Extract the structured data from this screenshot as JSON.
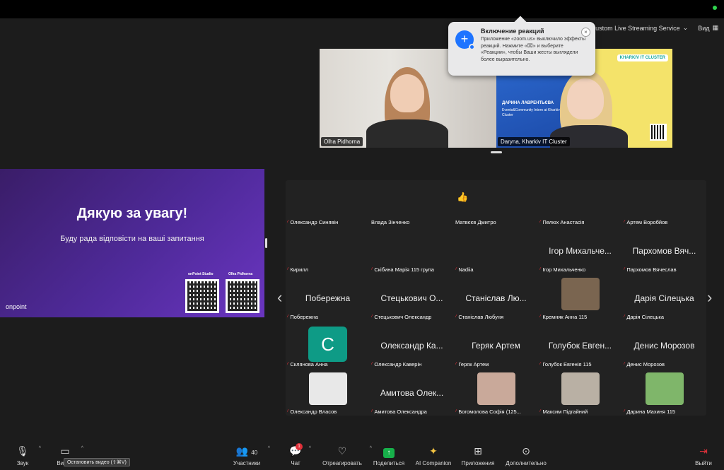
{
  "meeting": {
    "top_bar": {
      "live_label": "Custom Live Streaming Service",
      "view_label": "Вид"
    },
    "popup": {
      "title": "Включение реакций",
      "body": "Приложение «zoom.us» выключило эффекты реакций. Нажмите «⌧» и выберите «Реакции», чтобы Ваши жесты выглядели более выразительно.",
      "close": "×"
    },
    "videos": [
      {
        "name": "Olha Pidhorna"
      },
      {
        "name": "Daryna, Kharkiv IT Cluster",
        "banner_name": "ДАРИНА ЛАВРЕНТЬЄВА",
        "banner_role": "Events&Community Intern at Kharkiv IT Cluster",
        "logo": "KHARKIV IT CLUSTER"
      }
    ],
    "slide": {
      "title": "Дякую за увагу!",
      "subtitle": "Буду рада відповісти на ваші запитання",
      "logo": "onpoint",
      "qr1_label": "onPoint Studio",
      "qr2_label": "Olha Pidhorna"
    },
    "gallery": [
      {
        "label": "Олександр Синявін",
        "big": ""
      },
      {
        "label": "Влада Зінченко",
        "big": "",
        "nomic": true
      },
      {
        "label": "Матвєєв Дмитро",
        "big": "",
        "nomic": true,
        "emoji": "👍"
      },
      {
        "label": "Пелюх Анастасія",
        "big": ""
      },
      {
        "label": "Артем Воробйов",
        "big": ""
      },
      {
        "label": "Кирилл",
        "big": ""
      },
      {
        "label": "Скібина Марія 115 група",
        "big": ""
      },
      {
        "label": "Nadiia",
        "big": ""
      },
      {
        "label": "Ігор Михальченко",
        "big": "Ігор Михальче..."
      },
      {
        "label": "Пархомов Вячеслав",
        "big": "Пархомов Вяч..."
      },
      {
        "label": "Побережна",
        "big": "Побережна"
      },
      {
        "label": "Стецькович Олександр",
        "big": "Стецькович О..."
      },
      {
        "label": "Станіслав Любуня",
        "big": "Станіслав Лю..."
      },
      {
        "label": "Кремняк Анна 115",
        "big": "",
        "avatar": "#7a6550"
      },
      {
        "label": "Дарія Сілецька",
        "big": "Дарія Сілецька"
      },
      {
        "label": "Склянова Анна",
        "big": "",
        "letter": "C"
      },
      {
        "label": "Олександр Каверін",
        "big": "Олександр Ка..."
      },
      {
        "label": "Геряк Артем",
        "big": "Геряк Артем"
      },
      {
        "label": "Голубок Евгенія 115",
        "big": "Голубок Евген..."
      },
      {
        "label": "Денис Морозов",
        "big": "Денис Морозов"
      },
      {
        "label": "Олександр Власов",
        "big": "",
        "avatar": "#e8e8e8"
      },
      {
        "label": "Амитова Олександра",
        "big": "Амитова Олек..."
      },
      {
        "label": "Богомолова Софія (125...",
        "big": "",
        "avatar": "#c9a99a"
      },
      {
        "label": "Максим Підгайний",
        "big": "",
        "avatar": "#b9b0a4"
      },
      {
        "label": "Дарина Махиня 115",
        "big": "",
        "avatar": "#7fb66a"
      }
    ],
    "nav": {
      "prev": "‹",
      "next": "›"
    }
  },
  "toolbar": {
    "audio": "Звук",
    "video": "Видео",
    "video_tooltip": "Остановить видео (⇧⌘V)",
    "participants": "Участники",
    "participants_count": "40",
    "chat": "Чат",
    "chat_badge": "1",
    "react": "Отреагировать",
    "share": "Поделиться",
    "ai": "AI Companion",
    "apps": "Приложения",
    "more": "Дополнительно",
    "leave": "Выйти"
  }
}
